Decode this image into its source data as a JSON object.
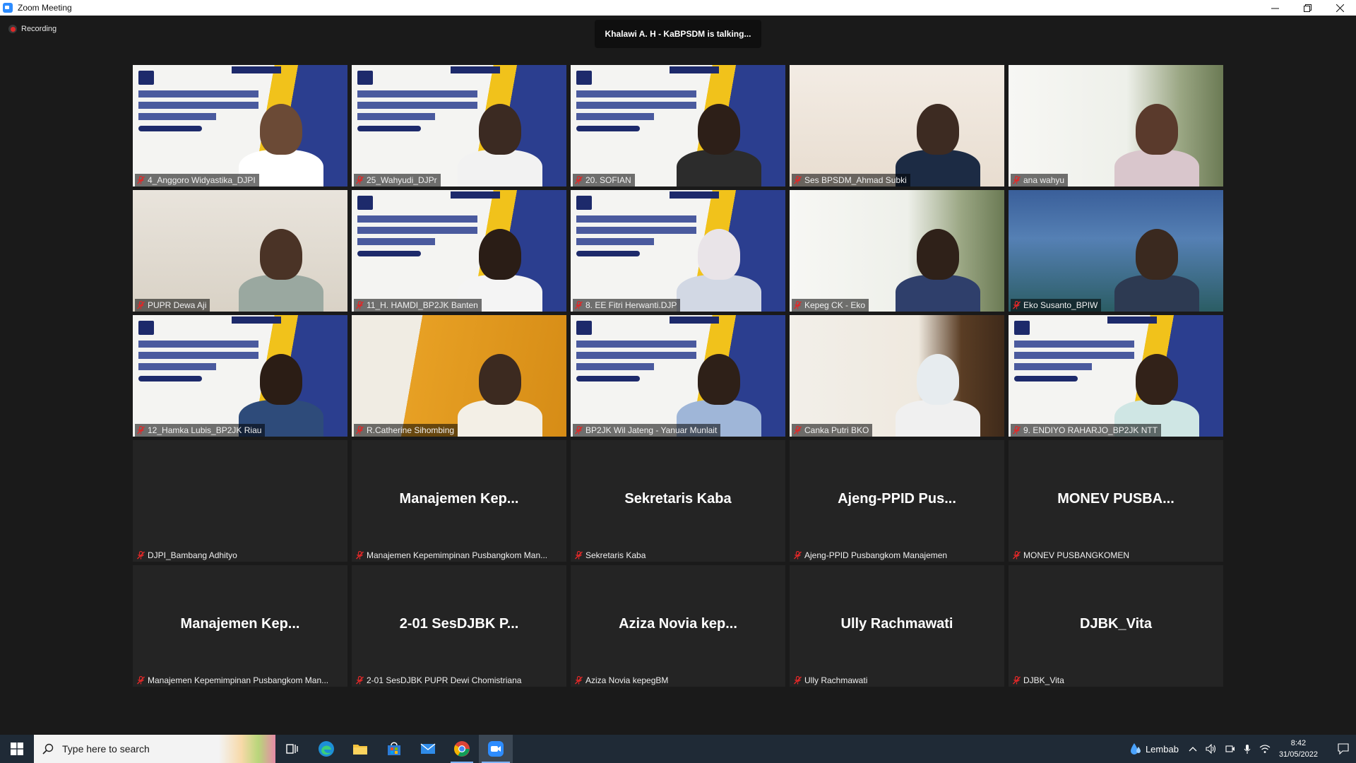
{
  "window": {
    "title": "Zoom Meeting"
  },
  "meeting": {
    "recording_label": "Recording",
    "talking_indicator": "Khalawi A. H - KaBPSDM is talking...",
    "participants": [
      {
        "name": "4_Anggoro Widyastika_DJPI",
        "video": true,
        "display": ""
      },
      {
        "name": "25_Wahyudi_DJPr",
        "video": true,
        "display": ""
      },
      {
        "name": "20. SOFIAN",
        "video": true,
        "display": ""
      },
      {
        "name": "Ses BPSDM_Ahmad Subki",
        "video": true,
        "display": ""
      },
      {
        "name": "ana wahyu",
        "video": true,
        "display": ""
      },
      {
        "name": "PUPR Dewa Aji",
        "video": true,
        "display": ""
      },
      {
        "name": "11_H. HAMDI_BP2JK Banten",
        "video": true,
        "display": ""
      },
      {
        "name": "8. EE Fitri Herwanti.DJP",
        "video": true,
        "display": ""
      },
      {
        "name": "Kepeg CK - Eko",
        "video": true,
        "display": ""
      },
      {
        "name": "Eko Susanto_BPIW",
        "video": true,
        "display": ""
      },
      {
        "name": "12_Hamka Lubis_BP2JK Riau",
        "video": true,
        "display": ""
      },
      {
        "name": "R.Catherine Sihombing",
        "video": true,
        "display": ""
      },
      {
        "name": "BP2JK Wil Jateng - Yanuar Munlait",
        "video": true,
        "display": ""
      },
      {
        "name": "Canka Putri BKO",
        "video": true,
        "display": ""
      },
      {
        "name": "9. ENDIYO RAHARJO_BP2JK NTT",
        "video": true,
        "display": ""
      },
      {
        "name": "DJPI_Bambang Adhityo",
        "video": false,
        "display": ""
      },
      {
        "name": "Manajemen Kepemimpinan Pusbangkom Man...",
        "video": false,
        "display": "Manajemen Kep..."
      },
      {
        "name": "Sekretaris Kaba",
        "video": false,
        "display": "Sekretaris Kaba"
      },
      {
        "name": "Ajeng-PPID Pusbangkom Manajemen",
        "video": false,
        "display": "Ajeng-PPID Pus..."
      },
      {
        "name": "MONEV PUSBANGKOMEN",
        "video": false,
        "display": "MONEV PUSBA..."
      },
      {
        "name": "Manajemen Kepemimpinan Pusbangkom Man...",
        "video": false,
        "display": "Manajemen Kep..."
      },
      {
        "name": "2-01 SesDJBK PUPR Dewi Chomistriana",
        "video": false,
        "display": "2-01 SesDJBK P..."
      },
      {
        "name": "Aziza Novia kepegBM",
        "video": false,
        "display": "Aziza Novia kep..."
      },
      {
        "name": "Ully Rachmawati",
        "video": false,
        "display": "Ully Rachmawati"
      },
      {
        "name": "DJBK_Vita",
        "video": false,
        "display": "DJBK_Vita"
      }
    ]
  },
  "taskbar": {
    "search_placeholder": "Type here to search",
    "apps": [
      "task-view",
      "edge",
      "file-explorer",
      "microsoft-store",
      "mail",
      "chrome",
      "zoom"
    ],
    "weather": "Lembab",
    "time": "8:42",
    "date": "31/05/2022"
  },
  "colors": {
    "meeting_bg": "#1a1a1a",
    "tile_bg": "#242424",
    "mute_red": "#e02828",
    "taskbar_bg": "#1f2a36"
  }
}
